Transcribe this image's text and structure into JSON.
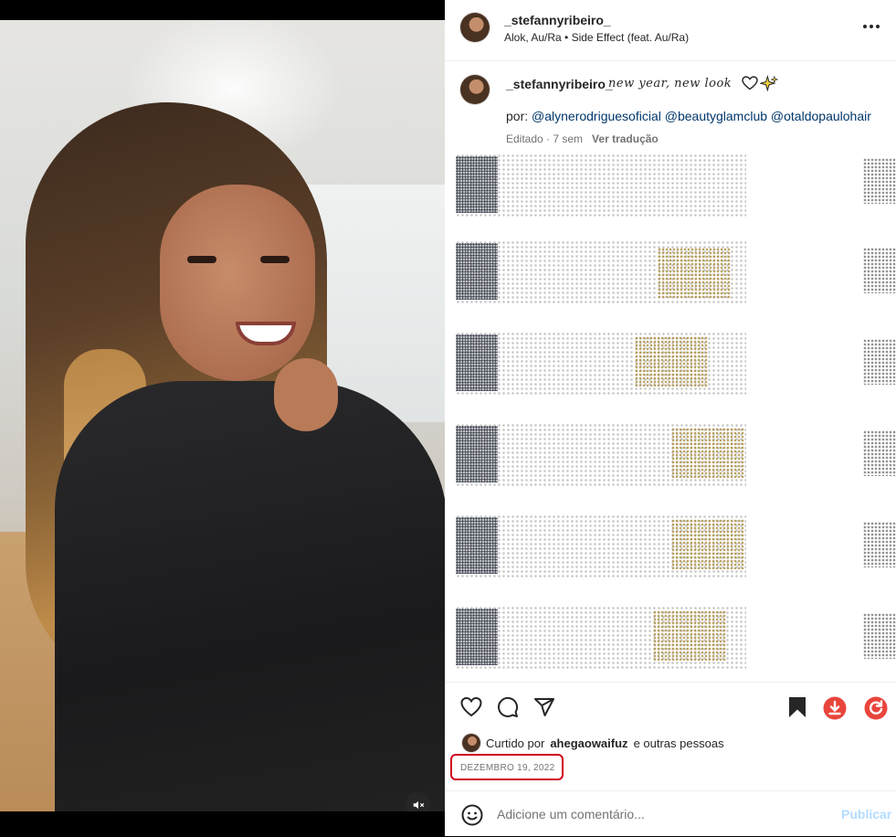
{
  "post": {
    "username": "_stefannyribeiro_",
    "audio": "Alok, Au/Ra • Side Effect (feat. Au/Ra)",
    "caption_user": "_stefannyribeiro_",
    "caption_text": "new year, new look",
    "credits_prefix": "por:",
    "credits": [
      "@alynerodriguesoficial",
      "@beautyglamclub",
      "@otaldopaulohair"
    ],
    "edited": "Editado · 7 sem",
    "translate": "Ver tradução",
    "liked_prefix": "Curtido por",
    "liked_user": "ahegaowaifuz",
    "liked_suffix": "e outras pessoas",
    "date": "DEZEMBRO 19, 2022",
    "comment_placeholder": "Adicione um comentário...",
    "publish": "Publicar"
  },
  "icons": {
    "more": "more-options-icon",
    "like": "heart-icon",
    "comment": "comment-icon",
    "share": "send-icon",
    "save": "bookmark-icon",
    "download": "download-icon",
    "refresh": "refresh-icon",
    "emoji": "emoji-icon",
    "mute": "mute-icon"
  },
  "colors": {
    "link": "#00376b",
    "muted": "#737373",
    "publish": "#b3dbff",
    "annotation": "#d0021b",
    "extension": "#e8453c"
  }
}
